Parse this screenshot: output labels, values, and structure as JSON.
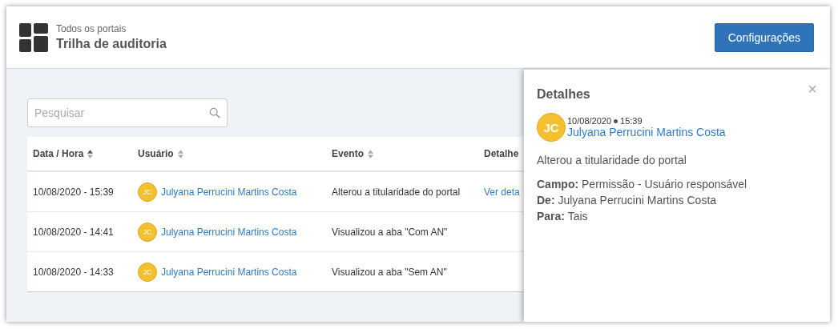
{
  "header": {
    "breadcrumb": "Todos os portais",
    "title": "Trilha de auditoria",
    "button": "Configurações"
  },
  "search": {
    "placeholder": "Pesquisar"
  },
  "table": {
    "columns": [
      {
        "label": "Data / Hora",
        "sortable": true
      },
      {
        "label": "Usuário",
        "sortable": true
      },
      {
        "label": "Evento",
        "sortable": true
      },
      {
        "label": "Detalhe",
        "sortable": false
      }
    ],
    "rows": [
      {
        "datetime": "10/08/2020 - 15:39",
        "initials": "JC",
        "user": "Julyana Perrucini Martins Costa",
        "event": "Alterou a titularidade do portal",
        "link": "Ver deta"
      },
      {
        "datetime": "10/08/2020 - 14:41",
        "initials": "JC",
        "user": "Julyana Perrucini Martins Costa",
        "event": "Visualizou a aba \"Com AN\""
      },
      {
        "datetime": "10/08/2020 - 14:33",
        "initials": "JC",
        "user": "Julyana Perrucini Martins Costa",
        "event": "Visualizou a aba \"Sem AN\""
      }
    ]
  },
  "details": {
    "title": "Detalhes",
    "close": "×",
    "initials": "JC",
    "date": "10/08/2020",
    "time": "15:39",
    "user": "Julyana Perrucini Martins Costa",
    "description": "Alterou a titularidade do portal",
    "fields": [
      "**Campo:** Permissão - Usuário responsável",
      "**De:** Julyana Perrucini Martins Costa",
      "**Para:** Tais"
    ]
  }
}
